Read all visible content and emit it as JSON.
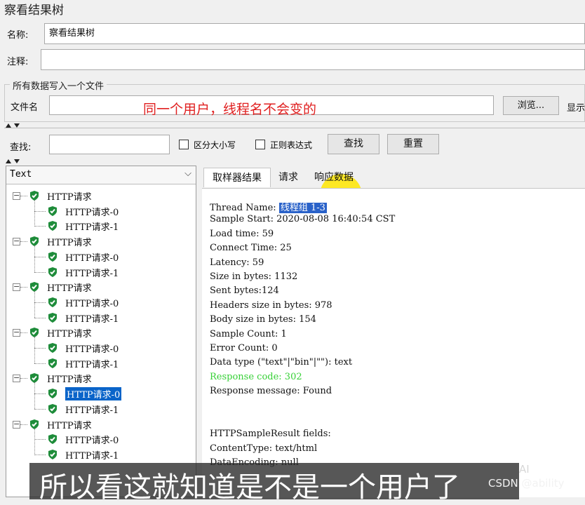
{
  "window": {
    "title": "察看结果树"
  },
  "form": {
    "name_label": "名称:",
    "name_value": "察看结果树",
    "comment_label": "注释:",
    "comment_value": ""
  },
  "file_group": {
    "title": "所有数据写入一个文件",
    "filename_label": "文件名",
    "filename_value": "",
    "browse_label": "浏览...",
    "display_label": "显示"
  },
  "annotation": {
    "note": "同一个用户，线程名不会变的"
  },
  "search": {
    "label": "查找:",
    "value": "",
    "case_label": "区分大小写",
    "regex_label": "正则表达式",
    "find_label": "查找",
    "reset_label": "重置"
  },
  "tree": {
    "renderer": "Text",
    "nodes": [
      {
        "label": "HTTP请求",
        "children": [
          "HTTP请求-0",
          "HTTP请求-1"
        ]
      },
      {
        "label": "HTTP请求",
        "children": [
          "HTTP请求-0",
          "HTTP请求-1"
        ]
      },
      {
        "label": "HTTP请求",
        "children": [
          "HTTP请求-0",
          "HTTP请求-1"
        ]
      },
      {
        "label": "HTTP请求",
        "children": [
          "HTTP请求-0",
          "HTTP请求-1"
        ]
      },
      {
        "label": "HTTP请求",
        "children": [
          "HTTP请求-0",
          "HTTP请求-1"
        ]
      },
      {
        "label": "HTTP请求",
        "children": [
          "HTTP请求-0",
          "HTTP请求-1"
        ]
      }
    ],
    "selected": "HTTP请求-0"
  },
  "tabs": [
    "取样器结果",
    "请求",
    "响应数据"
  ],
  "result": {
    "thread_name_label": "Thread Name: ",
    "thread_name_value": "线程组 1-3",
    "lines": [
      "Sample Start: 2020-08-08 16:40:54 CST",
      "Load time: 59",
      "Connect Time: 25",
      "Latency: 59",
      "Size in bytes: 1132",
      "Sent bytes:124",
      "Headers size in bytes: 978",
      "Body size in bytes: 154",
      "Sample Count: 1",
      "Error Count: 0",
      "Data type (\"text\"|\"bin\"|\"\"): text"
    ],
    "response_code": "Response code: 302",
    "response_message": "Response message: Found",
    "fields_lines": [
      "HTTPSampleResult fields:",
      "ContentType: text/html",
      "DataEncoding: null"
    ]
  },
  "overlay": {
    "subtitle": "所以看这就知道是不是一个用户了",
    "watermark": "CSDN @ability",
    "ai_badge": "AI"
  },
  "colors": {
    "selection": "#0a64c9",
    "success_green": "#36d036",
    "shield_green": "#1e8c3a",
    "note_red": "#e02020"
  }
}
